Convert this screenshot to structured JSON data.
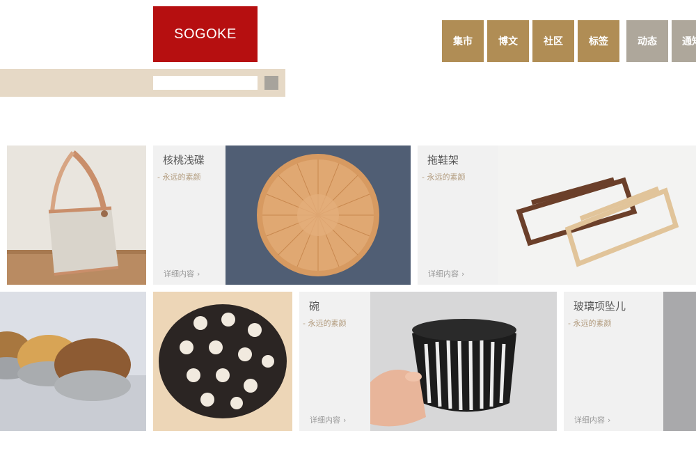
{
  "brand": {
    "logo_text": "SOGOKE",
    "logo_color": "#b60f10"
  },
  "search": {
    "placeholder": "",
    "value": ""
  },
  "nav": {
    "items": [
      {
        "label": "集市",
        "color": "#b08d55"
      },
      {
        "label": "博文",
        "color": "#b08d55"
      },
      {
        "label": "社区",
        "color": "#b08d55"
      },
      {
        "label": "标签",
        "color": "#b08d55"
      },
      {
        "label": "动态",
        "color": "#aea79b"
      },
      {
        "label": "通知",
        "color": "#aea79b"
      }
    ]
  },
  "products": [
    {
      "title": "核桃浅碟",
      "subtitle": "- 永远的素颜",
      "more": "详细内容"
    },
    {
      "title": "拖鞋架",
      "subtitle": "- 永远的素颜",
      "more": "详细内容"
    },
    {
      "title": "碗",
      "subtitle": "- 永远的素颜",
      "more": "详细内容"
    },
    {
      "title": "玻璃项坠儿",
      "subtitle": "- 永远的素颜",
      "more": "详细内容"
    }
  ],
  "icons": {
    "chevron": "chevron-right-icon",
    "search": "search-button"
  }
}
